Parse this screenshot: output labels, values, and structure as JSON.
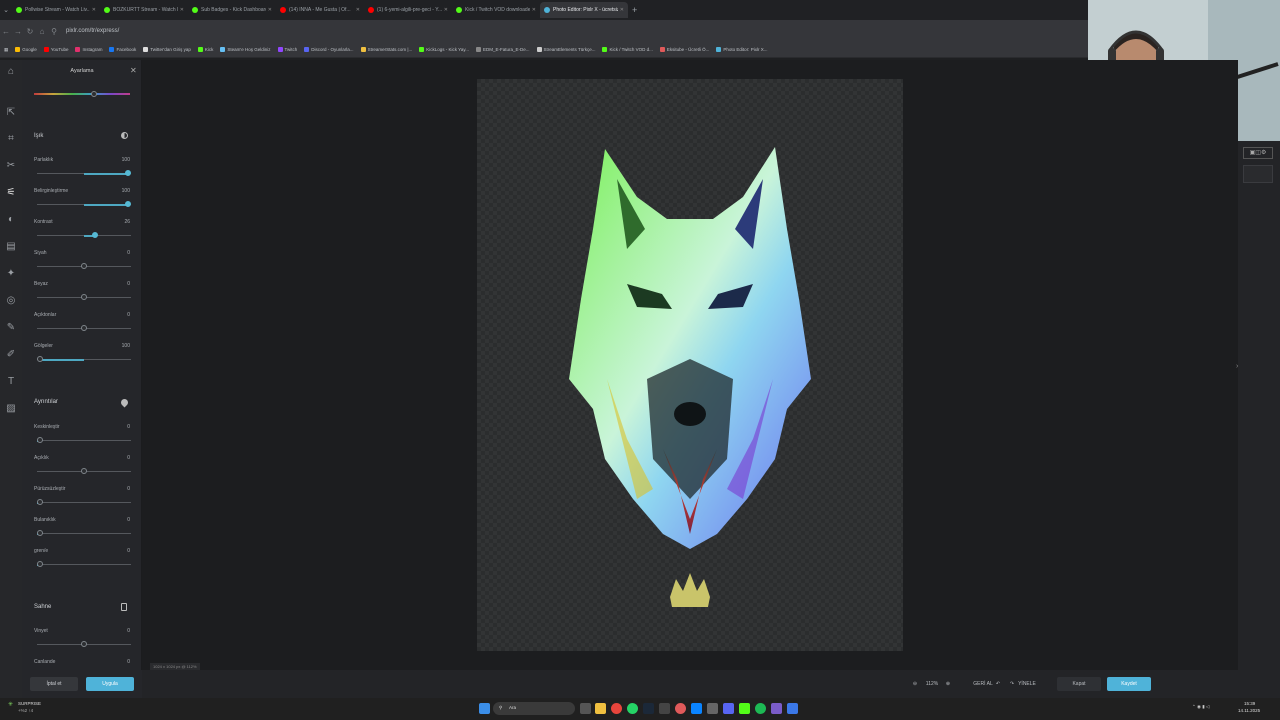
{
  "browser": {
    "tabs": [
      {
        "title": "Pollwise Stream - Watch Liv...",
        "color": "#53fc18",
        "active": false
      },
      {
        "title": "BOZKURTT Stream - Watch L...",
        "color": "#53fc18",
        "active": false
      },
      {
        "title": "Sub Badges - Kick Dashboard",
        "color": "#53fc18",
        "active": false
      },
      {
        "title": "(14) INNA - Me Gusta | Of...",
        "color": "#ff0000",
        "active": false
      },
      {
        "title": "(1) 6-yemi-algili-pre-geci - Y...",
        "color": "#ff0000",
        "active": false
      },
      {
        "title": "Kick / Twitch VOD downloader",
        "color": "#53fc18",
        "active": false
      },
      {
        "title": "Photo Editor: Pixlr X - ücretsiz...",
        "color": "#4fb3d9",
        "active": true
      }
    ],
    "url": "pixlr.com/tr/express/",
    "bookmarks": [
      "Google",
      "YouTube",
      "Instagram",
      "Facebook",
      "Twitter'dan Giriş yap",
      "Kick",
      "Steam'e Hoş Geldiniz",
      "Twitch",
      "Discord - Oyunlarla...",
      "StreamerStats.com |...",
      "KickLogs - Kick Yay...",
      "EDM_E-Fatura_E-De...",
      "StreamElements Türkçe...",
      "Kick / Twitch VOD d...",
      "Eksitube - Ücretli Ö...",
      "Photo Editor: Pixlr X..."
    ]
  },
  "panel": {
    "title": "Ayarlama",
    "sections": {
      "light": "Işık",
      "details": "Ayrıntılar",
      "scene": "Sahne"
    },
    "sliders": {
      "brightness": {
        "label": "Parlaklık",
        "value": "100",
        "level": 1.0
      },
      "clarity": {
        "label": "Belirginleştirme",
        "value": "100",
        "level": 1.0
      },
      "contrast": {
        "label": "Kontrast",
        "value": "26",
        "level": 0.63
      },
      "blacks": {
        "label": "Siyah",
        "value": "0",
        "level": 0.5
      },
      "whites": {
        "label": "Beyaz",
        "value": "0",
        "level": 0.5
      },
      "highlights": {
        "label": "Açıktonlar",
        "value": "0",
        "level": 0.5
      },
      "shadows": {
        "label": "Gölgeler",
        "value": "100",
        "level": 0.0
      },
      "sharpen": {
        "label": "Keskinleştir",
        "value": "0",
        "level": 0.0
      },
      "clarity2": {
        "label": "Açıklık",
        "value": "0",
        "level": 0.5
      },
      "smooth": {
        "label": "Pürüzsüzleştir",
        "value": "0",
        "level": 0.0
      },
      "blur": {
        "label": "Bulanıklık",
        "value": "0",
        "level": 0.0
      },
      "grain": {
        "label": "gren/e",
        "value": "0",
        "level": 0.0
      },
      "vignette": {
        "label": "Vinyet",
        "value": "0",
        "level": 0.5
      },
      "vibrance": {
        "label": "Canlande",
        "value": "0",
        "level": 0.5
      }
    },
    "cancel_label": "İptal et",
    "apply_label": "Uygula"
  },
  "canvas": {
    "dimensions": "1024 x 1024 px @ 112%"
  },
  "bottombar": {
    "zoom": "112%",
    "undo": "GERİ AL",
    "redo": "YİNELE",
    "close": "Kapat",
    "save": "Kaydet"
  },
  "taskbar": {
    "weather": "SURPRISE",
    "weather_sub": "+%2 ↑4",
    "search": "Ara",
    "time": "15:39",
    "date": "14.11.2025"
  }
}
